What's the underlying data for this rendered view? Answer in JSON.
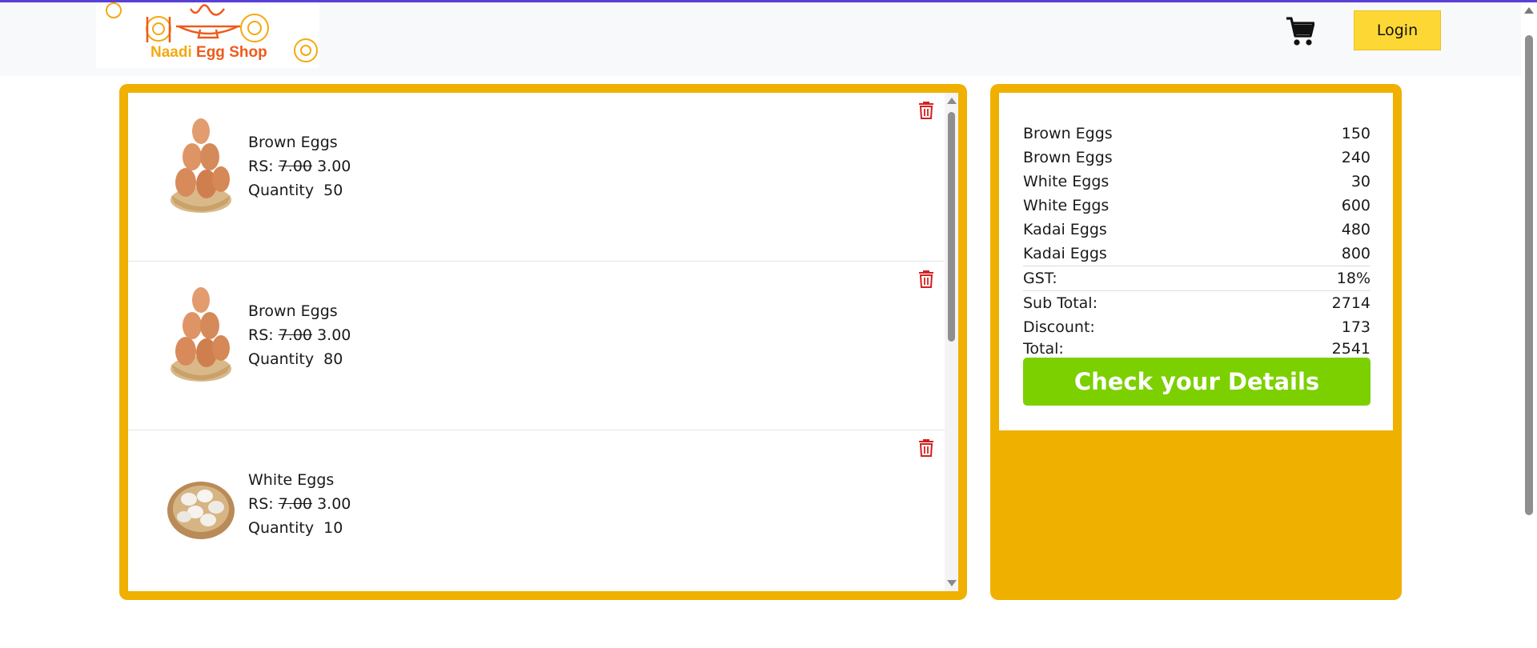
{
  "header": {
    "logo_text_a": "Naadi ",
    "logo_text_b": "Egg Shop",
    "cart_icon": "shopping-cart-icon",
    "login_label": "Login"
  },
  "cart": {
    "items": [
      {
        "name": "Brown Eggs",
        "price_prefix": "RS: ",
        "old_price": "7.00",
        "new_price": "3.00",
        "qty_label": "Quantity",
        "qty": "50",
        "image": "brown-eggs-basket"
      },
      {
        "name": "Brown Eggs",
        "price_prefix": "RS: ",
        "old_price": "7.00",
        "new_price": "3.00",
        "qty_label": "Quantity",
        "qty": "80",
        "image": "brown-eggs-basket"
      },
      {
        "name": "White Eggs",
        "price_prefix": "RS: ",
        "old_price": "7.00",
        "new_price": "3.00",
        "qty_label": "Quantity",
        "qty": "10",
        "image": "white-eggs-basket"
      }
    ],
    "delete_icon": "trash-icon"
  },
  "summary": {
    "lines": [
      {
        "label": "Brown Eggs",
        "value": "150"
      },
      {
        "label": "Brown Eggs",
        "value": "240"
      },
      {
        "label": "White Eggs",
        "value": "30"
      },
      {
        "label": "White Eggs",
        "value": "600"
      },
      {
        "label": "Kadai Eggs",
        "value": "480"
      },
      {
        "label": "Kadai Eggs",
        "value": "800"
      }
    ],
    "gst_label": "GST:",
    "gst_value": "18%",
    "subtotal_label": "Sub Total:",
    "subtotal_value": "2714",
    "discount_label": "Discount:",
    "discount_value": "173",
    "total_label": "Total:",
    "total_value": "2541",
    "check_button": "Check your Details"
  },
  "colors": {
    "panel": "#f0b000",
    "login": "#fdd835",
    "check": "#7cd000",
    "trash": "#d32020",
    "topline": "#5a3fd6"
  }
}
